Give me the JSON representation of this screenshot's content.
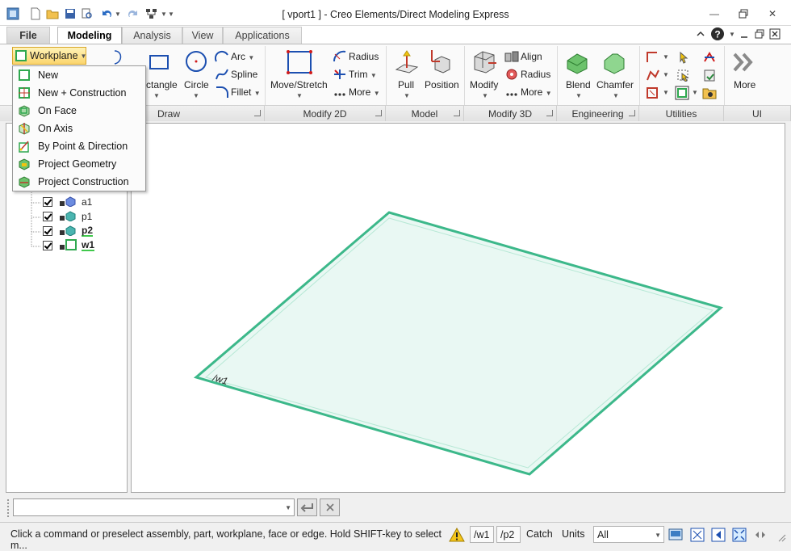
{
  "window": {
    "title": "[ vport1 ] - Creo Elements/Direct Modeling Express"
  },
  "tabs": {
    "file": "File",
    "modeling": "Modeling",
    "analysis": "Analysis",
    "view": "View",
    "applications": "Applications"
  },
  "ribbon": {
    "workplane": "Workplane",
    "rectangle": "ctangle",
    "circle": "Circle",
    "arc": "Arc",
    "spline": "Spline",
    "fillet": "Fillet",
    "move_stretch": "Move/Stretch",
    "radius2d": "Radius",
    "trim": "Trim",
    "more2d": "More",
    "pull": "Pull",
    "position": "Position",
    "modify": "Modify",
    "align": "Align",
    "radius3d": "Radius",
    "more3d": "More",
    "blend": "Blend",
    "chamfer": "Chamfer",
    "more_ui": "More",
    "groups": {
      "draw": "Draw",
      "modify2d": "Modify 2D",
      "model": "Model",
      "modify3d": "Modify 3D",
      "engineering": "Engineering",
      "utilities": "Utilities",
      "ui": "UI"
    }
  },
  "workplane_menu": [
    {
      "label": "New",
      "icon": "workplane-new-icon"
    },
    {
      "label": "New + Construction",
      "icon": "workplane-construction-icon"
    },
    {
      "label": "On Face",
      "icon": "on-face-icon"
    },
    {
      "label": "On Axis",
      "icon": "on-axis-icon"
    },
    {
      "label": "By Point & Direction",
      "icon": "point-direction-icon"
    },
    {
      "label": "Project Geometry",
      "icon": "project-geometry-icon"
    },
    {
      "label": "Project Construction",
      "icon": "project-construction-icon"
    }
  ],
  "tree": {
    "items": [
      {
        "label": "a1",
        "bold": false
      },
      {
        "label": "p1",
        "bold": false
      },
      {
        "label": "p2",
        "bold": true
      },
      {
        "label": "w1",
        "bold": true
      }
    ]
  },
  "viewport": {
    "workplane_label": "/w1"
  },
  "status": {
    "prompt": "Click a command or preselect assembly, part, workplane, face or edge. Hold SHIFT-key to select m...",
    "active_workplane": "/w1",
    "active_part": "/p2",
    "catch": "Catch",
    "units": "Units",
    "filter": "All"
  },
  "colors": {
    "accent": "#2fa36b",
    "workplane_fill": "#e9f8f3",
    "highlight": "#fde38a"
  }
}
